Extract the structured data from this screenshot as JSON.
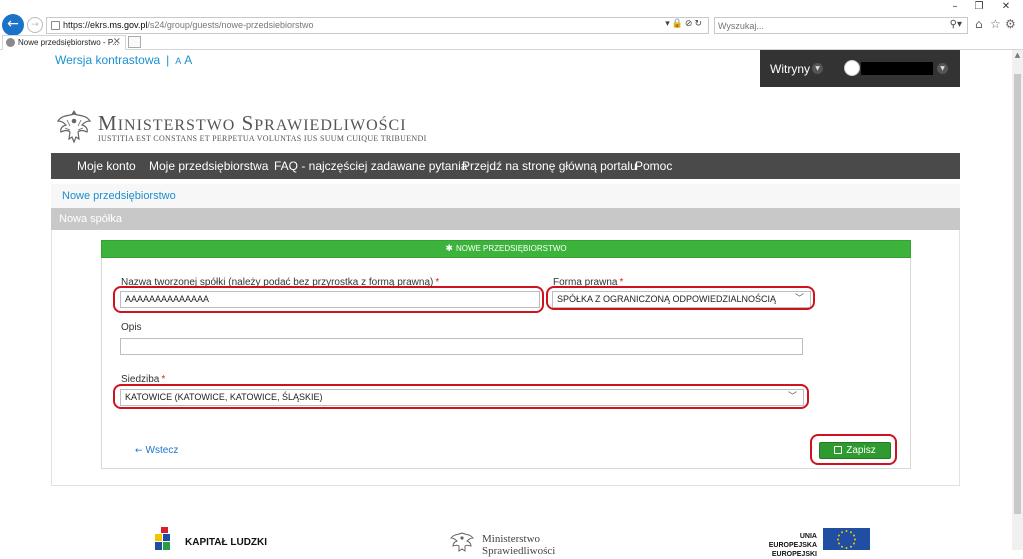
{
  "browser": {
    "url_prefix": "https://ekrs.",
    "url_domain": "ms.gov.pl",
    "url_path": "/s24/group/guests/nowe-przedsiebiorstwo",
    "search_placeholder": "Wyszukaj...",
    "tab_title": "Nowe przedsiębiorstwo - P..."
  },
  "top": {
    "contrast_label": "Wersja kontrastowa",
    "separator": "|",
    "font_small": "A",
    "font_large": "A"
  },
  "dockbar": {
    "sites_label": "Witryny"
  },
  "logo": {
    "name_first_cap": "M",
    "name_first_rest": "INISTERSTWO",
    "name_second_cap": "S",
    "name_second_rest": "PRAWIEDLIWOŚCI",
    "motto": "IUSTITIA EST CONSTANS ET PERPETUA VOLUNTAS IUS SUUM CUIQUE TRIBUENDI"
  },
  "nav": {
    "items": [
      "Moje konto",
      "Moje przedsiębiorstwa",
      "FAQ - najczęściej zadawane pytania",
      "Przejdź na stronę główną portalu",
      "Pomoc"
    ]
  },
  "breadcrumb": "Nowe przedsiębiorstwo",
  "portlet_title": "Nowa spółka",
  "form": {
    "header": "NOWE PRZEDSIĘBIORSTWO",
    "name_label": "Nazwa tworzonej spółki (należy podać bez przyrostka z formą prawną)",
    "name_value": "AAAAAAAAAAAAAA",
    "legal_form_label": "Forma prawna",
    "legal_form_value": "SPÓŁKA Z OGRANICZONĄ ODPOWIEDZIALNOŚCIĄ",
    "description_label": "Opis",
    "description_value": "",
    "seat_label": "Siedziba",
    "seat_value": "KATOWICE (KATOWICE, KATOWICE, ŚLĄSKIE)",
    "required_mark": "*",
    "back_label": "Wstecz",
    "save_label": "Zapisz"
  },
  "footer": {
    "kl_text": "KAPITAŁ LUDZKI",
    "ms_line1": "Ministerstwo",
    "ms_line2": "Sprawiedliwości",
    "ue_line1": "UNIA EUROPEJSKA",
    "ue_line2": "EUROPEJSKI"
  },
  "colors": {
    "accent_link": "#1a8fd0",
    "nav_bg": "#4a4a4a",
    "card_header_green": "#3cb43c",
    "save_green": "#2f9a2f",
    "annotation_red": "#d0121e"
  }
}
